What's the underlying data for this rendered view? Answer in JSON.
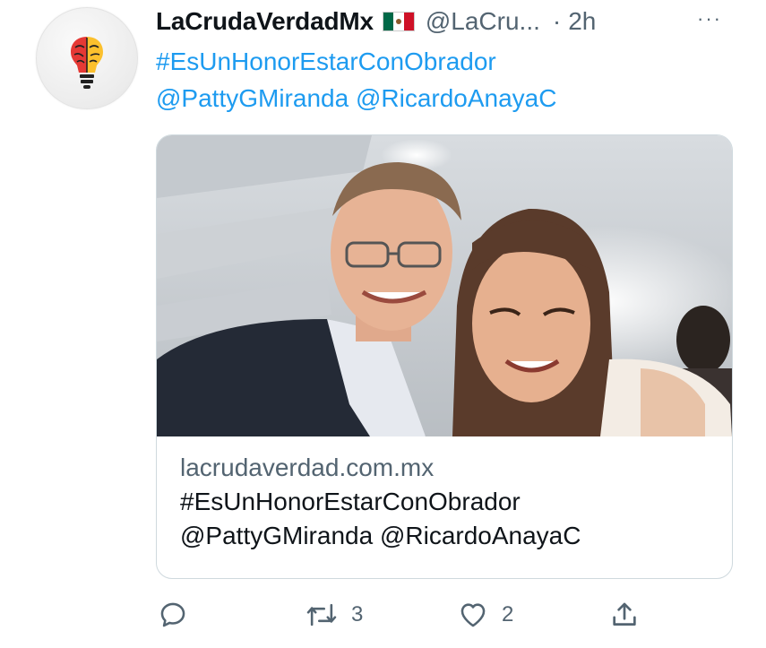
{
  "tweet": {
    "display_name": "LaCrudaVerdadMx",
    "flag_icon": "mexico-flag-icon",
    "handle": "@LaCru...",
    "separator": "·",
    "time": "2h",
    "more": "···",
    "text_lines": [
      "#EsUnHonorEstarConObrador",
      "@PattyGMiranda @RicardoAnayaC"
    ]
  },
  "avatar": {
    "icon": "brain-lightbulb-icon"
  },
  "card": {
    "image": "photo of a man and a woman smiling in a selfie",
    "domain": "lacrudaverdad.com.mx",
    "title_lines": [
      "#EsUnHonorEstarConObrador",
      "@PattyGMiranda @RicardoAnayaC"
    ]
  },
  "actions": {
    "reply_icon": "reply-icon",
    "retweet_icon": "retweet-icon",
    "retweet_count": "3",
    "like_icon": "heart-icon",
    "like_count": "2",
    "share_icon": "share-icon"
  },
  "colors": {
    "link": "#1d9bf0",
    "secondary": "#536471",
    "border": "#cfd9de",
    "text": "#0f1419"
  }
}
